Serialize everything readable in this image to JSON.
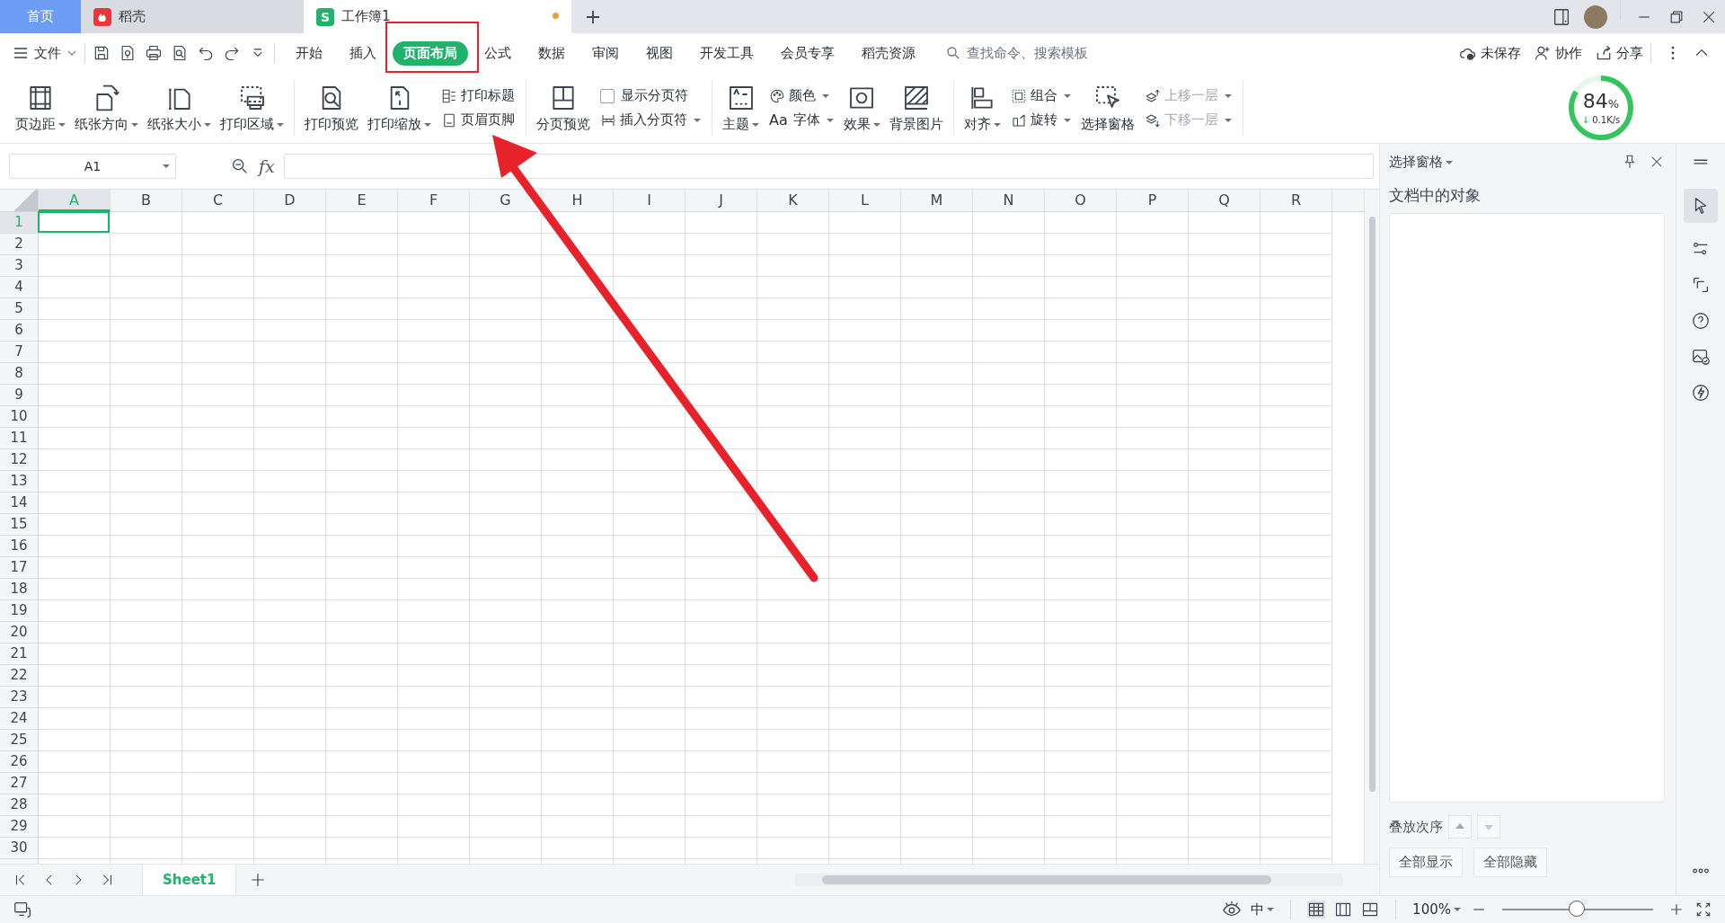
{
  "tabs": [
    {
      "label": "首页",
      "kind": "home",
      "selected": false,
      "modified": false
    },
    {
      "label": "稻壳",
      "kind": "docer",
      "selected": false,
      "modified": false
    },
    {
      "label": "工作簿1",
      "kind": "sheet",
      "icon_letter": "S",
      "selected": true,
      "modified": true
    }
  ],
  "menu": {
    "file_label": "文件",
    "tabs": [
      {
        "label": "开始",
        "selected": false
      },
      {
        "label": "插入",
        "selected": false
      },
      {
        "label": "页面布局",
        "selected": true
      },
      {
        "label": "公式",
        "selected": false
      },
      {
        "label": "数据",
        "selected": false
      },
      {
        "label": "审阅",
        "selected": false
      },
      {
        "label": "视图",
        "selected": false
      },
      {
        "label": "开发工具",
        "selected": false
      },
      {
        "label": "会员专享",
        "selected": false
      },
      {
        "label": "稻壳资源",
        "selected": false
      }
    ],
    "search_placeholder": "查找命令、搜索模板",
    "actions": [
      {
        "label": "未保存"
      },
      {
        "label": "协作"
      },
      {
        "label": "分享"
      }
    ]
  },
  "ribbon": {
    "groups": [
      {
        "items": [
          {
            "kind": "large",
            "label": "页边距",
            "dropdown": true
          },
          {
            "kind": "large",
            "label": "纸张方向",
            "dropdown": true
          },
          {
            "kind": "large",
            "label": "纸张大小",
            "dropdown": true
          },
          {
            "kind": "large",
            "label": "打印区域",
            "dropdown": true
          }
        ]
      },
      {
        "items": [
          {
            "kind": "large",
            "label": "打印预览",
            "dropdown": false
          },
          {
            "kind": "large",
            "label": "打印缩放",
            "dropdown": true
          },
          {
            "kind": "stack",
            "items": [
              {
                "kind": "small",
                "label": "打印标题",
                "dropdown": false,
                "disabled": false
              },
              {
                "kind": "small",
                "label": "页眉页脚",
                "dropdown": false,
                "disabled": false
              }
            ]
          }
        ]
      },
      {
        "items": [
          {
            "kind": "large",
            "label": "分页预览",
            "dropdown": false
          },
          {
            "kind": "stack",
            "items": [
              {
                "kind": "checkbox",
                "label": "显示分页符",
                "checked": false
              },
              {
                "kind": "small",
                "label": "插入分页符",
                "dropdown": true,
                "disabled": false
              }
            ]
          }
        ]
      },
      {
        "items": [
          {
            "kind": "large",
            "label": "主题",
            "dropdown": true
          },
          {
            "kind": "stack",
            "items": [
              {
                "kind": "small",
                "label": "颜色",
                "dropdown": true,
                "disabled": false
              },
              {
                "kind": "small",
                "glyph": "Aa",
                "label": "字体",
                "dropdown": true,
                "disabled": false
              }
            ]
          },
          {
            "kind": "large",
            "label": "效果",
            "dropdown": true
          },
          {
            "kind": "large",
            "label": "背景图片",
            "dropdown": false
          }
        ]
      },
      {
        "items": [
          {
            "kind": "large",
            "label": "对齐",
            "dropdown": true
          },
          {
            "kind": "stack",
            "items": [
              {
                "kind": "small",
                "label": "组合",
                "dropdown": true,
                "disabled": false
              },
              {
                "kind": "small",
                "label": "旋转",
                "dropdown": true,
                "disabled": false
              }
            ]
          },
          {
            "kind": "large",
            "label": "选择窗格",
            "dropdown": false
          },
          {
            "kind": "stack",
            "items": [
              {
                "kind": "small",
                "label": "上移一层",
                "dropdown": true,
                "disabled": true
              },
              {
                "kind": "small",
                "label": "下移一层",
                "dropdown": true,
                "disabled": true
              }
            ]
          }
        ]
      }
    ]
  },
  "speed_widget": {
    "percent": "84",
    "unit": "%",
    "rate_arrow": "↓",
    "rate": "0.1K/s",
    "level": 0.84
  },
  "name_box": "A1",
  "fx_label": "fx",
  "grid": {
    "columns": [
      {
        "label": "A",
        "selected": true
      },
      {
        "label": "B",
        "selected": false
      },
      {
        "label": "C",
        "selected": false
      },
      {
        "label": "D",
        "selected": false
      },
      {
        "label": "E",
        "selected": false
      },
      {
        "label": "F",
        "selected": false
      },
      {
        "label": "G",
        "selected": false
      },
      {
        "label": "H",
        "selected": false
      },
      {
        "label": "I",
        "selected": false
      },
      {
        "label": "J",
        "selected": false
      },
      {
        "label": "K",
        "selected": false
      },
      {
        "label": "L",
        "selected": false
      },
      {
        "label": "M",
        "selected": false
      },
      {
        "label": "N",
        "selected": false
      },
      {
        "label": "O",
        "selected": false
      },
      {
        "label": "P",
        "selected": false
      },
      {
        "label": "Q",
        "selected": false
      },
      {
        "label": "R",
        "selected": false
      }
    ],
    "rows": [
      {
        "label": "1",
        "selected": true
      },
      {
        "label": "2",
        "selected": false
      },
      {
        "label": "3",
        "selected": false
      },
      {
        "label": "4",
        "selected": false
      },
      {
        "label": "5",
        "selected": false
      },
      {
        "label": "6",
        "selected": false
      },
      {
        "label": "7",
        "selected": false
      },
      {
        "label": "8",
        "selected": false
      },
      {
        "label": "9",
        "selected": false
      },
      {
        "label": "10",
        "selected": false
      },
      {
        "label": "11",
        "selected": false
      },
      {
        "label": "12",
        "selected": false
      },
      {
        "label": "13",
        "selected": false
      },
      {
        "label": "14",
        "selected": false
      },
      {
        "label": "15",
        "selected": false
      },
      {
        "label": "16",
        "selected": false
      },
      {
        "label": "17",
        "selected": false
      },
      {
        "label": "18",
        "selected": false
      },
      {
        "label": "19",
        "selected": false
      },
      {
        "label": "20",
        "selected": false
      },
      {
        "label": "21",
        "selected": false
      },
      {
        "label": "22",
        "selected": false
      },
      {
        "label": "23",
        "selected": false
      },
      {
        "label": "24",
        "selected": false
      },
      {
        "label": "25",
        "selected": false
      },
      {
        "label": "26",
        "selected": false
      },
      {
        "label": "27",
        "selected": false
      },
      {
        "label": "28",
        "selected": false
      },
      {
        "label": "29",
        "selected": false
      },
      {
        "label": "30",
        "selected": false
      }
    ]
  },
  "sheets": [
    {
      "label": "Sheet1",
      "selected": true
    }
  ],
  "selection_pane": {
    "title": "选择窗格",
    "heading": "文档中的对象",
    "order_label": "叠放次序",
    "buttons": [
      {
        "label": "全部显示"
      },
      {
        "label": "全部隐藏"
      }
    ]
  },
  "status_bar": {
    "input_method": "中",
    "zoom": "100%",
    "zoom_level": {
      "level": 0.5
    }
  }
}
